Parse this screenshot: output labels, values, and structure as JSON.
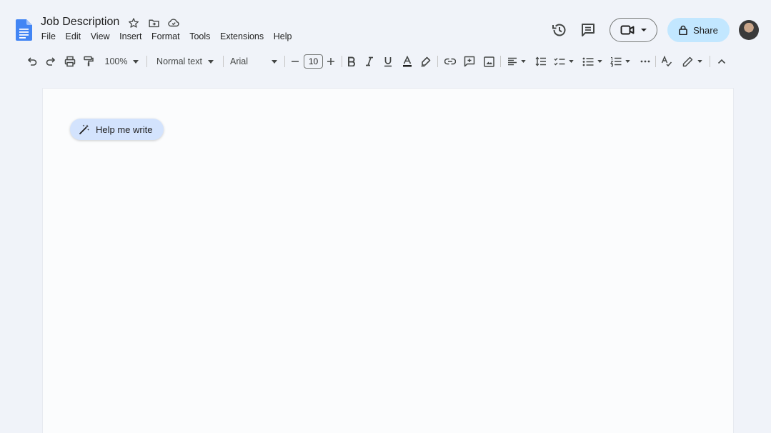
{
  "app": {
    "doc_title": "Job Description",
    "logo_icon": "google-docs-icon",
    "brand_color": "#4285f4"
  },
  "menu": [
    "File",
    "Edit",
    "View",
    "Insert",
    "Format",
    "Tools",
    "Extensions",
    "Help"
  ],
  "header_actions": {
    "share_label": "Share",
    "share_color": "#c2e7ff"
  },
  "toolbar": {
    "zoom": "100%",
    "style": "Normal text",
    "font": "Arial",
    "font_size": "10"
  },
  "document": {
    "help_me_write_label": "Help me write",
    "help_me_write_color": "#d3e3fd"
  }
}
